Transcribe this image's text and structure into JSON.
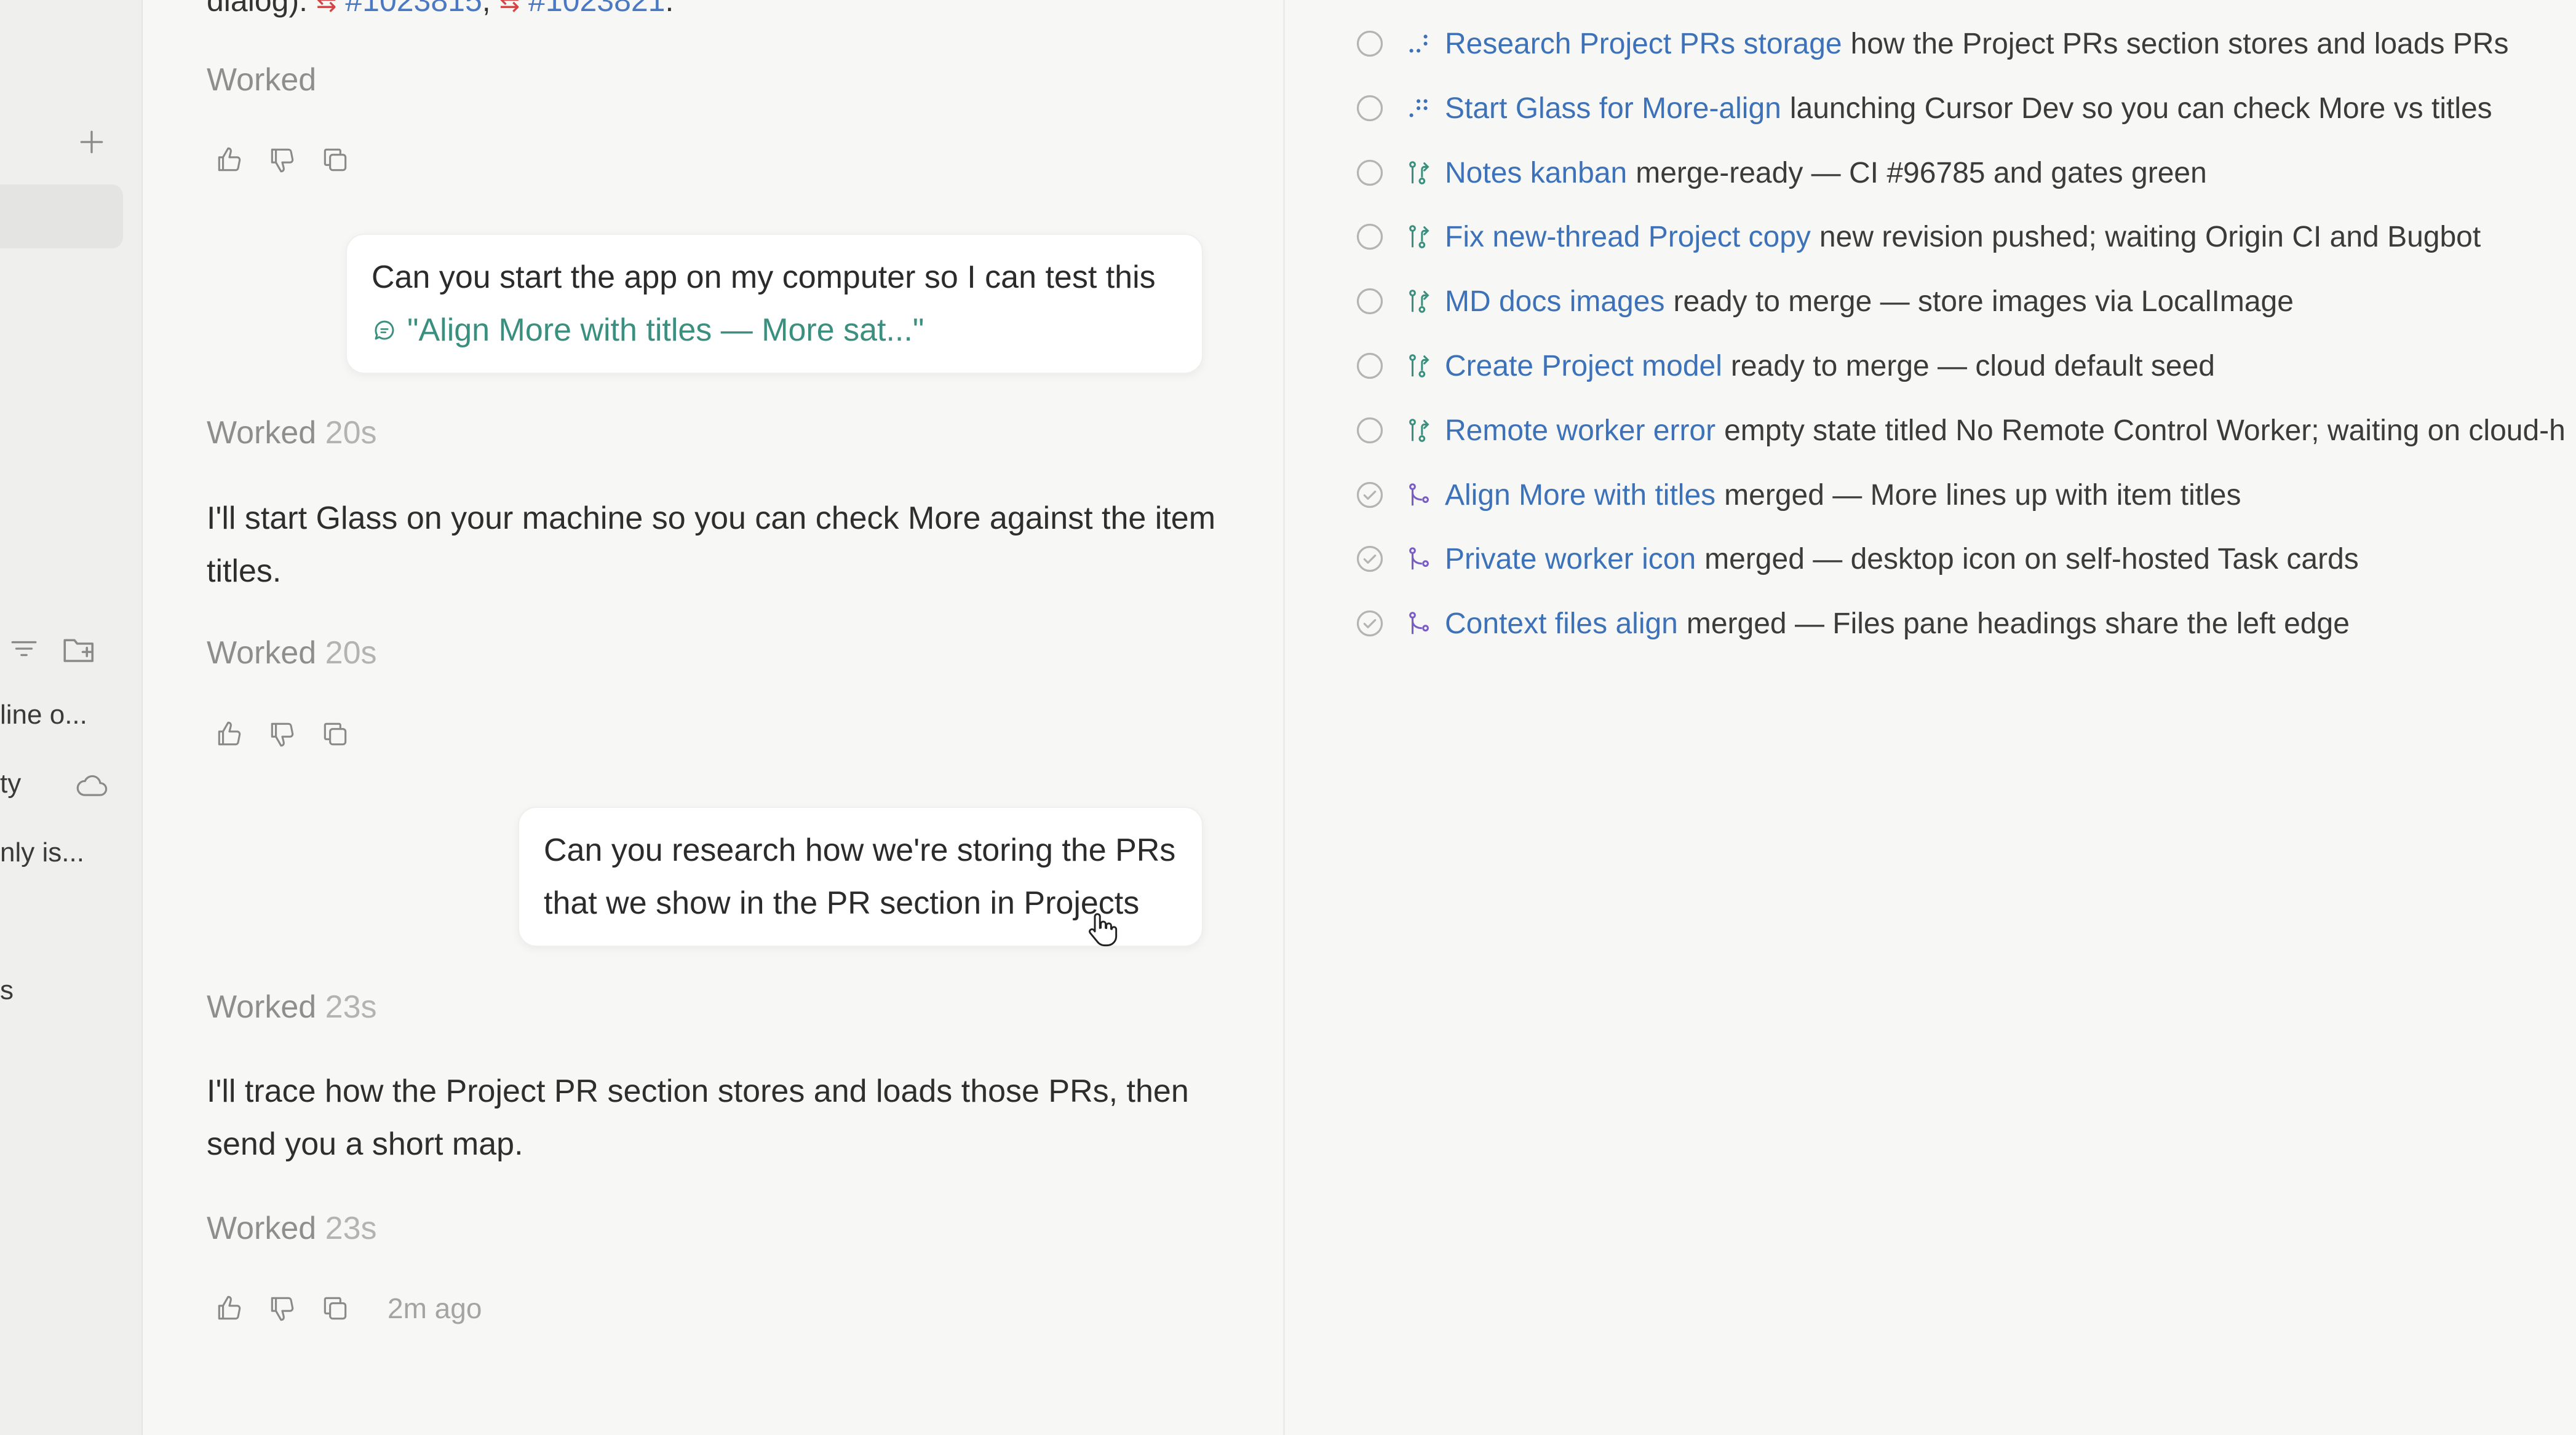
{
  "sidebar": {
    "items": [
      {
        "label": "line o..."
      },
      {
        "label": "ty"
      },
      {
        "label": "nly is..."
      },
      {
        "label": "s"
      }
    ]
  },
  "chat": {
    "top_line": {
      "prefix": "dialog):",
      "pr_icon": "⇆",
      "pr1": "#1023815",
      "sep": ",",
      "pr2": "#1023821",
      "suffix": "."
    },
    "worked_label": "Worked",
    "blocks": [
      {
        "worked": "Worked",
        "duration": ""
      },
      {
        "user": "Can you start the app on my computer so I can test this",
        "quote": "\"Align More with titles — More sat...\""
      },
      {
        "worked": "Worked",
        "duration": "20s"
      },
      {
        "assistant": "I'll start Glass on your machine so you can check More against the item titles."
      },
      {
        "worked": "Worked",
        "duration": "20s"
      },
      {
        "user": "Can you research how we're storing the PRs that we show in the PR section in Projects"
      },
      {
        "worked": "Worked",
        "duration": "23s"
      },
      {
        "assistant": "I'll trace how the Project PR section stores and loads those PRs, then send you a short map."
      },
      {
        "worked": "Worked",
        "duration": "23s"
      }
    ],
    "time_ago": "2m ago"
  },
  "tasks": [
    {
      "status": "open",
      "kind": "research-icon",
      "title": "Research Project PRs storage",
      "desc": "how the Project PRs section stores and loads PRs"
    },
    {
      "status": "open",
      "kind": "start-icon",
      "title": "Start Glass for More-align",
      "desc": "launching Cursor Dev so you can check More vs titles"
    },
    {
      "status": "open",
      "kind": "pr-icon",
      "title": "Notes kanban",
      "desc": "merge-ready — CI #96785 and gates green"
    },
    {
      "status": "open",
      "kind": "pr-icon",
      "title": "Fix new-thread Project copy",
      "desc": "new revision pushed; waiting Origin CI and Bugbot"
    },
    {
      "status": "open",
      "kind": "pr-icon",
      "title": "MD docs images",
      "desc": "ready to merge — store images via LocalImage"
    },
    {
      "status": "open",
      "kind": "pr-icon",
      "title": "Create Project model",
      "desc": "ready to merge — cloud default seed"
    },
    {
      "status": "open",
      "kind": "pr-icon",
      "title": "Remote worker error",
      "desc": "empty state titled No Remote Control Worker; waiting on cloud-h"
    },
    {
      "status": "done",
      "kind": "merged-icon",
      "title": "Align More with titles",
      "desc": "merged — More lines up with item titles"
    },
    {
      "status": "done",
      "kind": "merged-icon",
      "title": "Private worker icon",
      "desc": "merged — desktop icon on self-hosted Task cards"
    },
    {
      "status": "done",
      "kind": "merged-icon",
      "title": "Context files align",
      "desc": "merged — Files pane headings share the left edge"
    }
  ],
  "colors": {
    "link": "#3d72b8",
    "quote": "#3a8f7e",
    "pr_red": "#d04545"
  }
}
